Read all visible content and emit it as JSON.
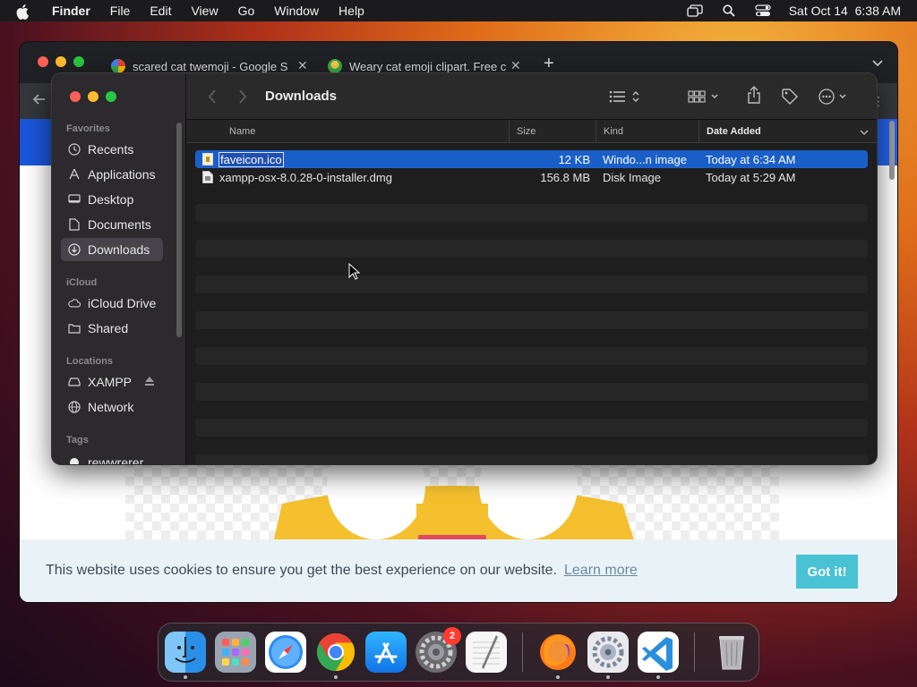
{
  "menubar": {
    "app": "Finder",
    "items": [
      "File",
      "Edit",
      "View",
      "Go",
      "Window",
      "Help"
    ],
    "datetime": "Sat Oct 14  6:38 AM"
  },
  "browser": {
    "tabs": [
      {
        "title": "scared cat twemoji - Google S"
      },
      {
        "title": "Weary cat emoji clipart. Free c"
      }
    ],
    "new_tab": "+",
    "cookie_banner": {
      "text": "This website uses cookies to ensure you get the best experience on our website.",
      "learn_more": "Learn more",
      "button": "Got it!"
    }
  },
  "finder": {
    "title": "Downloads",
    "sidebar": {
      "favorites_header": "Favorites",
      "favorites": [
        {
          "label": "Recents",
          "icon": "clock-icon"
        },
        {
          "label": "Applications",
          "icon": "applications-icon"
        },
        {
          "label": "Desktop",
          "icon": "desktop-icon"
        },
        {
          "label": "Documents",
          "icon": "document-icon"
        },
        {
          "label": "Downloads",
          "icon": "download-icon",
          "active": true
        }
      ],
      "icloud_header": "iCloud",
      "icloud": [
        {
          "label": "iCloud Drive",
          "icon": "cloud-icon"
        },
        {
          "label": "Shared",
          "icon": "shared-folder-icon"
        }
      ],
      "locations_header": "Locations",
      "locations": [
        {
          "label": "XAMPP",
          "icon": "drive-icon"
        },
        {
          "label": "Network",
          "icon": "globe-icon"
        }
      ],
      "tags_header": "Tags",
      "tags": [
        {
          "label": "rewwrerer"
        }
      ]
    },
    "columns": {
      "name": "Name",
      "size": "Size",
      "kind": "Kind",
      "date_added": "Date Added"
    },
    "files": [
      {
        "name": "faveicon.ico",
        "size": "12 KB",
        "kind": "Windo...n image",
        "date": "Today at 6:34 AM",
        "selected": true
      },
      {
        "name": "xampp-osx-8.0.28-0-installer.dmg",
        "size": "156.8 MB",
        "kind": "Disk Image",
        "date": "Today at 5:29 AM",
        "selected": false
      }
    ]
  },
  "dock": {
    "apps": [
      "Finder",
      "Launchpad",
      "Safari",
      "Chrome",
      "App Store",
      "System Settings",
      "TextEdit",
      "Firefox",
      "System Preferences",
      "Visual Studio Code",
      "Trash"
    ],
    "settings_badge": "2"
  },
  "colors": {
    "selection": "#1a5fc8",
    "cookie_button": "#49c2d3",
    "traffic_red": "#ff5f57",
    "traffic_yellow": "#febc2e",
    "traffic_green": "#28c840"
  }
}
